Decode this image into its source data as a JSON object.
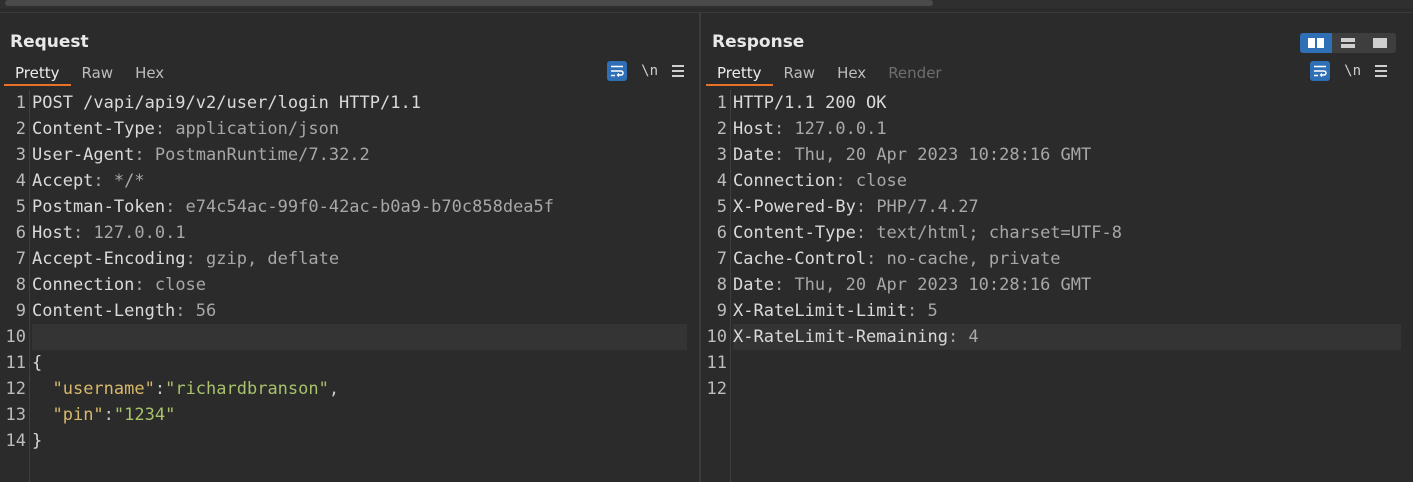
{
  "layout_buttons": [
    "side-by-side",
    "top-bottom",
    "single"
  ],
  "request": {
    "title": "Request",
    "tabs": [
      "Pretty",
      "Raw",
      "Hex"
    ],
    "active_tab": "Pretty",
    "tools": {
      "newline": "\\n"
    },
    "lines": [
      {
        "n": "1",
        "name": "POST /vapi/api9/v2/user/login HTTP/1.1",
        "sep": "",
        "value": ""
      },
      {
        "n": "2",
        "name": "Content-Type",
        "sep": ": ",
        "value": "application/json"
      },
      {
        "n": "3",
        "name": "User-Agent",
        "sep": ": ",
        "value": "PostmanRuntime/7.32.2"
      },
      {
        "n": "4",
        "name": "Accept",
        "sep": ": ",
        "value": "*/*"
      },
      {
        "n": "5",
        "name": "Postman-Token",
        "sep": ": ",
        "value": "e74c54ac-99f0-42ac-b0a9-b70c858dea5f"
      },
      {
        "n": "6",
        "name": "Host",
        "sep": ": ",
        "value": "127.0.0.1"
      },
      {
        "n": "7",
        "name": "Accept-Encoding",
        "sep": ": ",
        "value": "gzip, deflate"
      },
      {
        "n": "8",
        "name": "Connection",
        "sep": ": ",
        "value": "close"
      },
      {
        "n": "9",
        "name": "Content-Length",
        "sep": ": ",
        "value": "56"
      },
      {
        "n": "10",
        "name": "",
        "sep": "",
        "value": ""
      },
      {
        "n": "11",
        "name": "{",
        "sep": "",
        "value": ""
      },
      {
        "n": "12",
        "indent": "  ",
        "key": "\"username\"",
        "colon": ":",
        "str": "\"richardbranson\"",
        "tail": ","
      },
      {
        "n": "13",
        "indent": "  ",
        "key": "\"pin\"",
        "colon": ":",
        "str": "\"1234\"",
        "tail": ""
      },
      {
        "n": "14",
        "name": "}",
        "sep": "",
        "value": ""
      }
    ]
  },
  "response": {
    "title": "Response",
    "tabs": [
      "Pretty",
      "Raw",
      "Hex",
      "Render"
    ],
    "active_tab": "Pretty",
    "tools": {
      "newline": "\\n"
    },
    "lines": [
      {
        "n": "1",
        "name": "HTTP/1.1 200 OK",
        "sep": "",
        "value": ""
      },
      {
        "n": "2",
        "name": "Host",
        "sep": ": ",
        "value": "127.0.0.1"
      },
      {
        "n": "3",
        "name": "Date",
        "sep": ": ",
        "value": "Thu, 20 Apr 2023 10:28:16 GMT"
      },
      {
        "n": "4",
        "name": "Connection",
        "sep": ": ",
        "value": "close"
      },
      {
        "n": "5",
        "name": "X-Powered-By",
        "sep": ": ",
        "value": "PHP/7.4.27"
      },
      {
        "n": "6",
        "name": "Content-Type",
        "sep": ": ",
        "value": "text/html; charset=UTF-8"
      },
      {
        "n": "7",
        "name": "Cache-Control",
        "sep": ": ",
        "value": "no-cache, private"
      },
      {
        "n": "8",
        "name": "Date",
        "sep": ": ",
        "value": "Thu, 20 Apr 2023 10:28:16 GMT"
      },
      {
        "n": "9",
        "name": "X-RateLimit-Limit",
        "sep": ": ",
        "value": "5"
      },
      {
        "n": "10",
        "name": "X-RateLimit-Remaining",
        "sep": ": ",
        "value": "4"
      },
      {
        "n": "11",
        "name": "",
        "sep": "",
        "value": ""
      },
      {
        "n": "12",
        "name": "",
        "sep": "",
        "value": ""
      }
    ]
  },
  "colors": {
    "accent": "#e8722a",
    "toggle_active": "#2f6fb5",
    "json_key": "#d8b86a",
    "json_string": "#a7c26a"
  }
}
